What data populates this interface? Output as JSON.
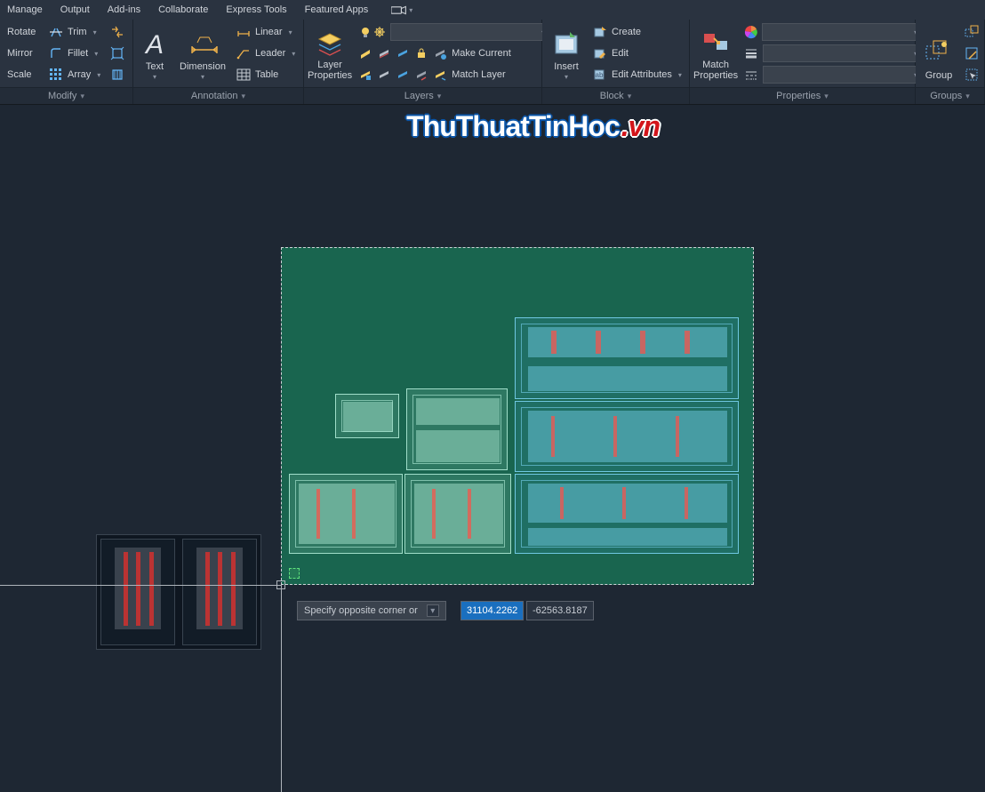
{
  "menu": {
    "items": [
      "Manage",
      "Output",
      "Add-ins",
      "Collaborate",
      "Express Tools",
      "Featured Apps"
    ]
  },
  "ribbon": {
    "modify": {
      "title": "Modify",
      "rotate": "Rotate",
      "mirror": "Mirror",
      "scale": "Scale",
      "trim": "Trim",
      "fillet": "Fillet",
      "array": "Array"
    },
    "annotation": {
      "title": "Annotation",
      "text": "Text",
      "dimension": "Dimension",
      "linear": "Linear",
      "leader": "Leader",
      "table": "Table"
    },
    "layers": {
      "title": "Layers",
      "layer_props": "Layer\nProperties",
      "make_current": "Make Current",
      "match_layer": "Match Layer"
    },
    "block": {
      "title": "Block",
      "insert": "Insert",
      "create": "Create",
      "edit": "Edit",
      "edit_attr": "Edit Attributes"
    },
    "properties": {
      "title": "Properties",
      "match": "Match\nProperties"
    },
    "groups": {
      "title": "Groups",
      "group": "Group"
    }
  },
  "watermark": {
    "a": "ThuThuatTinHoc",
    "b": ".vn"
  },
  "command": {
    "prompt": "Specify opposite corner or",
    "x": "31104.2262",
    "y": "-62563.8187"
  }
}
